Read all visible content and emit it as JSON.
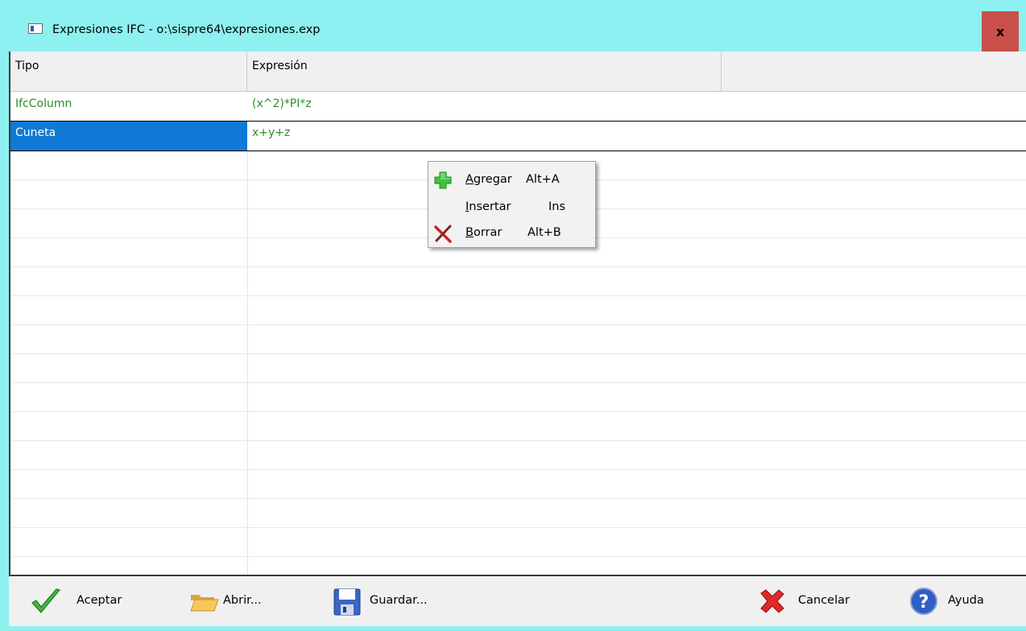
{
  "window": {
    "title": "Expresiones IFC - o:\\sispre64\\expresiones.exp",
    "close_label": "x"
  },
  "grid": {
    "headers": [
      "Tipo",
      "Expresión"
    ],
    "rows": [
      {
        "tipo": "IfcColumn",
        "expresion": "(x^2)*PI*z"
      },
      {
        "tipo": "Cuneta",
        "expresion": "x+y+z"
      }
    ],
    "selected_row": 1
  },
  "context_menu": {
    "items": [
      {
        "mnemonic": "A",
        "rest": "gregar",
        "shortcut": "Alt+A",
        "icon": "green-plus-icon"
      },
      {
        "mnemonic": "I",
        "rest": "nsertar",
        "shortcut": "Ins",
        "icon": ""
      },
      {
        "mnemonic": "B",
        "rest": "orrar",
        "shortcut": "Alt+B",
        "icon": "red-x-icon"
      }
    ]
  },
  "toolbar": {
    "aceptar": "Aceptar",
    "abrir": "Abrir...",
    "guardar": "Guardar...",
    "cancelar": "Cancelar",
    "ayuda": "Ayuda"
  },
  "colors": {
    "titlebar": "#8ef0f0",
    "selection": "#0f7ad6",
    "data_text": "#2a8f2a",
    "close_button": "#c9504a"
  }
}
